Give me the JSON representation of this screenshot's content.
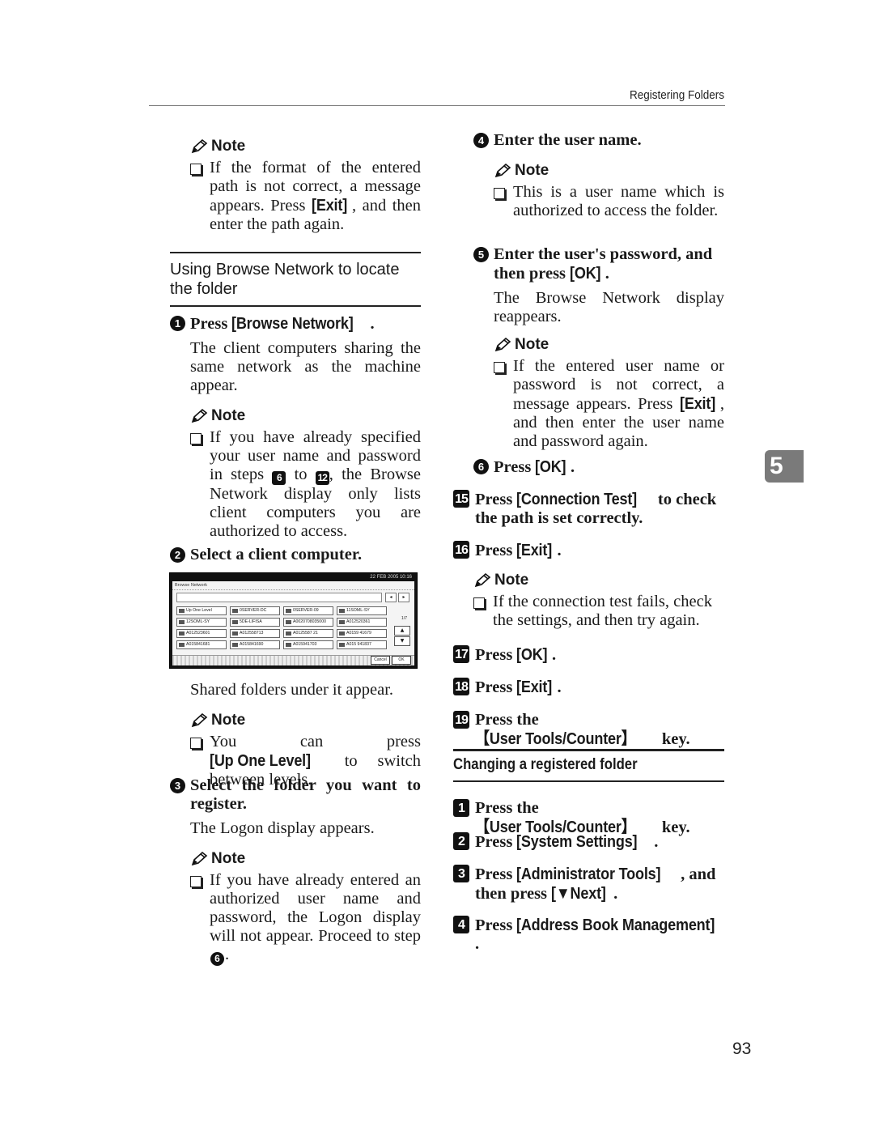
{
  "header": {
    "running_title": "Registering Folders"
  },
  "chapter_tab": "5",
  "page_number": "93",
  "left_column": {
    "note1": {
      "label": "Note",
      "text_before": "If the format of the entered path is not correct, a message appears. Press ",
      "keyword": "[Exit]",
      "text_after": ", and then enter the path again."
    },
    "section_title": "Using Browse Network to locate the folder",
    "step1": {
      "num": "1",
      "prefix": "Press ",
      "keyword": "[Browse Network]",
      "suffix": ".",
      "body": "The client computers sharing the same network as the machine appear."
    },
    "note2": {
      "label": "Note",
      "text_a": "If you have already specified your user name and password in steps ",
      "step_ref_a": "6",
      "text_b": " to ",
      "step_ref_b": "12",
      "text_c": ", the Browse Network display only lists client computers you are authorized to access."
    },
    "step2": {
      "num": "2",
      "text": "Select a client computer."
    },
    "screenshot": {
      "datetime": "22 FEB 2005 10:16",
      "title": "Browse Network",
      "nav_prev": "◂",
      "nav_next": "▸",
      "page_indicator": "1/7",
      "scroll_up": "▲",
      "scroll_down": "▼",
      "cancel_label": "Cancel",
      "ok_label": "OK",
      "items": [
        "Up One Level",
        "0SERVER-DC",
        "0SERVER-09",
        "11SOML-SY",
        "12SOML-SY",
        "5DE-LIFISA",
        "A0020708035000",
        "A012520361",
        "A012523601",
        "A012558713",
        "A0125587 21",
        "A0159 41679",
        "A015841681",
        "A015841690",
        "A015941703",
        "A015 941837"
      ]
    },
    "after_screenshot": "Shared folders under it appear.",
    "note3": {
      "label": "Note",
      "text_before": "You can press ",
      "keyword": "[Up One Level]",
      "text_after": " to switch between levels."
    },
    "step3": {
      "num": "3",
      "text": "Select the folder you want to register.",
      "body": "The Logon display appears."
    },
    "note4": {
      "label": "Note",
      "text_before": "If you have already entered an authorized user name and password, the Logon display will not appear. Proceed to step ",
      "step_ref": "6",
      "text_after": "."
    }
  },
  "right_column": {
    "step4": {
      "num": "4",
      "text": "Enter the user name."
    },
    "note5": {
      "label": "Note",
      "text": "This is a user name which is authorized to access the folder."
    },
    "step5": {
      "num": "5",
      "text_before": "Enter the user's password, and then press ",
      "keyword": "[OK]",
      "text_after": ".",
      "body": "The Browse Network display reappears."
    },
    "note6": {
      "label": "Note",
      "text_before": "If the entered user name or password is not correct, a message appears. Press ",
      "keyword": "[Exit]",
      "text_after": ", and then enter the user name and password again."
    },
    "step6": {
      "num": "6",
      "prefix": "Press ",
      "keyword": "[OK]",
      "suffix": "."
    },
    "step15": {
      "num": "15",
      "prefix": "Press ",
      "keyword": "[Connection Test]",
      "suffix": " to check the path is set correctly."
    },
    "step16": {
      "num": "16",
      "prefix": "Press ",
      "keyword": "[Exit]",
      "suffix": "."
    },
    "note7": {
      "label": "Note",
      "text": "If the connection test fails, check the settings, and then try again."
    },
    "step17": {
      "num": "17",
      "prefix": "Press ",
      "keyword": "[OK]",
      "suffix": "."
    },
    "step18": {
      "num": "18",
      "prefix": "Press ",
      "keyword": "[Exit]",
      "suffix": "."
    },
    "step19": {
      "num": "19",
      "prefix": "Press the ",
      "keyword": "【User Tools/Counter】",
      "suffix": " key."
    },
    "section_title": "Changing a registered folder",
    "c1": {
      "num": "1",
      "prefix": "Press the ",
      "keyword": "【User Tools/Counter】",
      "suffix": " key."
    },
    "c2": {
      "num": "2",
      "prefix": "Press ",
      "keyword": "[System Settings]",
      "suffix": "."
    },
    "c3": {
      "num": "3",
      "prefix": "Press ",
      "keyword": "[Administrator Tools]",
      "mid": ", and then press ",
      "keyword2": "[▼Next]",
      "suffix": "."
    },
    "c4": {
      "num": "4",
      "prefix": "Press ",
      "keyword": "[Address Book Management]",
      "suffix": "."
    }
  }
}
